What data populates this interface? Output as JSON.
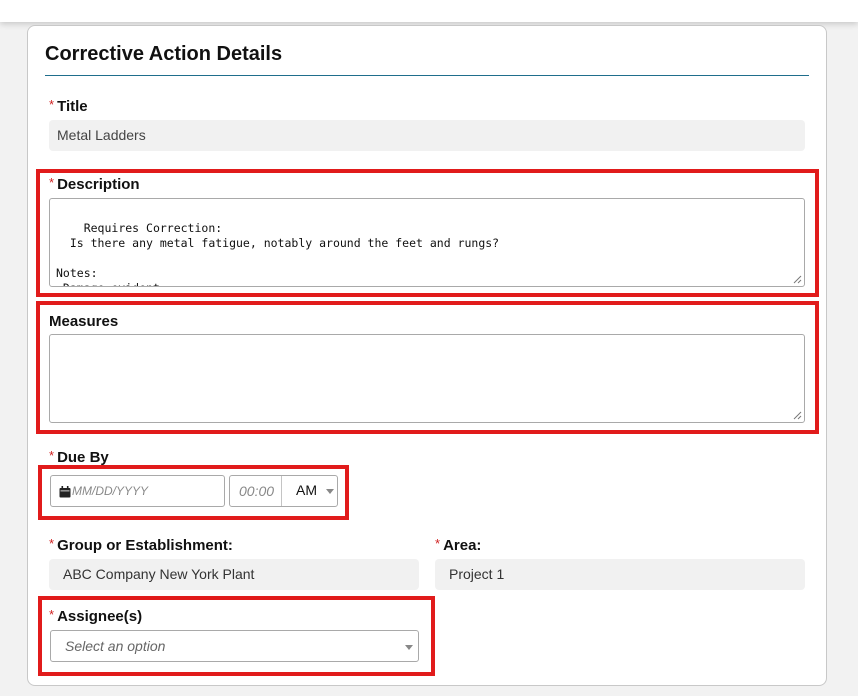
{
  "card": {
    "title": "Corrective Action Details"
  },
  "required_marker": "*",
  "fields": {
    "title": {
      "label": "Title",
      "value": "Metal Ladders"
    },
    "description": {
      "label": "Description",
      "value": "Requires Correction:\n  Is there any metal fatigue, notably around the feet and rungs?\n\nNotes:\n Damage evident"
    },
    "measures": {
      "label": "Measures",
      "value": ""
    },
    "due_by": {
      "label": "Due By",
      "date_placeholder": "MM/DD/YYYY",
      "time_placeholder": "00:00",
      "ampm": "AM",
      "icons": {
        "calendar": "calendar-icon",
        "dropdown": "chevron-down-icon"
      }
    },
    "group": {
      "label": "Group or Establishment:",
      "value": "ABC Company New York Plant"
    },
    "area": {
      "label": "Area:",
      "value": "Project 1"
    },
    "assignees": {
      "label": "Assignee(s)",
      "placeholder": "Select an option"
    }
  },
  "colors": {
    "highlight": "#e11b1b",
    "required": "#d02020",
    "title_rule": "#1f6e8c",
    "readonly_bg": "#f1f1f1"
  }
}
